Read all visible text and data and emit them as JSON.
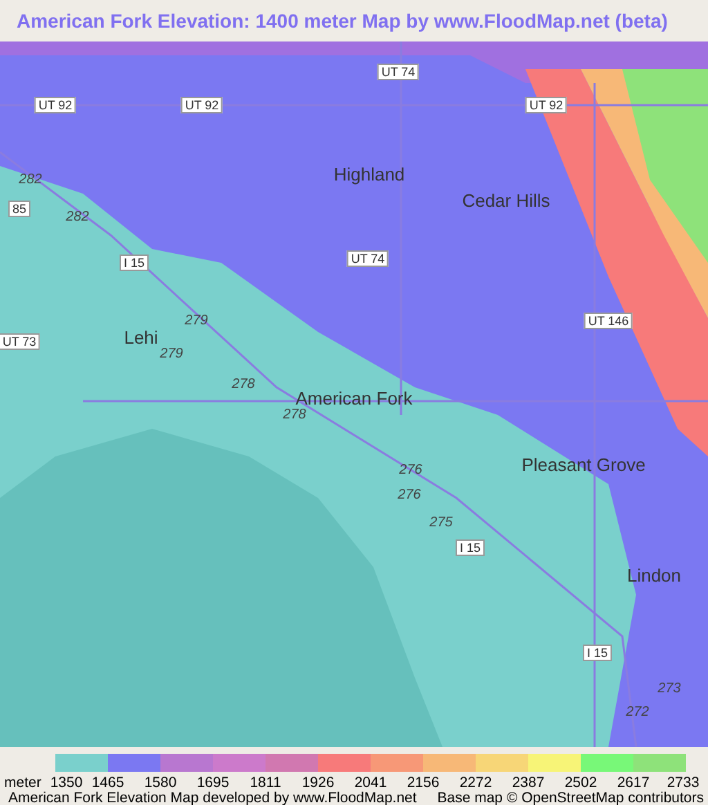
{
  "title": "American Fork Elevation: 1400 meter Map by www.FloodMap.net (beta)",
  "map": {
    "labels": [
      {
        "kind": "road",
        "text": "UT 74"
      },
      {
        "kind": "road",
        "text": "UT 92"
      },
      {
        "kind": "road",
        "text": "UT 92"
      },
      {
        "kind": "road",
        "text": "UT 92"
      },
      {
        "kind": "place",
        "text": "Highland"
      },
      {
        "kind": "place",
        "text": "Cedar Hills"
      },
      {
        "kind": "elevation",
        "text": "282"
      },
      {
        "kind": "road",
        "text": "85"
      },
      {
        "kind": "elevation",
        "text": "282"
      },
      {
        "kind": "road",
        "text": "I 15"
      },
      {
        "kind": "road",
        "text": "UT 74"
      },
      {
        "kind": "road",
        "text": "UT 146"
      },
      {
        "kind": "place",
        "text": "Lehi"
      },
      {
        "kind": "road",
        "text": "UT 73"
      },
      {
        "kind": "elevation",
        "text": "279"
      },
      {
        "kind": "elevation",
        "text": "279"
      },
      {
        "kind": "elevation",
        "text": "278"
      },
      {
        "kind": "place",
        "text": "American Fork"
      },
      {
        "kind": "elevation",
        "text": "278"
      },
      {
        "kind": "place",
        "text": "Pleasant Grove"
      },
      {
        "kind": "elevation",
        "text": "276"
      },
      {
        "kind": "elevation",
        "text": "276"
      },
      {
        "kind": "elevation",
        "text": "275"
      },
      {
        "kind": "road",
        "text": "I 15"
      },
      {
        "kind": "place",
        "text": "Lindon"
      },
      {
        "kind": "road",
        "text": "I 15"
      },
      {
        "kind": "elevation",
        "text": "273"
      },
      {
        "kind": "elevation",
        "text": "272"
      }
    ]
  },
  "legend": {
    "unit": "meter",
    "swatches": [
      {
        "color": "#7ad0cc"
      },
      {
        "color": "#7b78f2"
      },
      {
        "color": "#b877d0"
      },
      {
        "color": "#cc7acb"
      },
      {
        "color": "#d178b0"
      },
      {
        "color": "#f77a7a"
      },
      {
        "color": "#f79877"
      },
      {
        "color": "#f7b877"
      },
      {
        "color": "#f7d677"
      },
      {
        "color": "#f7f477"
      },
      {
        "color": "#78f878"
      },
      {
        "color": "#8ee27a"
      }
    ],
    "ticks": [
      "1350",
      "1465",
      "1580",
      "1695",
      "1811",
      "1926",
      "2041",
      "2156",
      "2272",
      "2387",
      "2502",
      "2617",
      "2733"
    ]
  },
  "footer": {
    "left": "American Fork Elevation Map developed by www.FloodMap.net",
    "right": "Base map © OpenStreetMap contributors"
  }
}
